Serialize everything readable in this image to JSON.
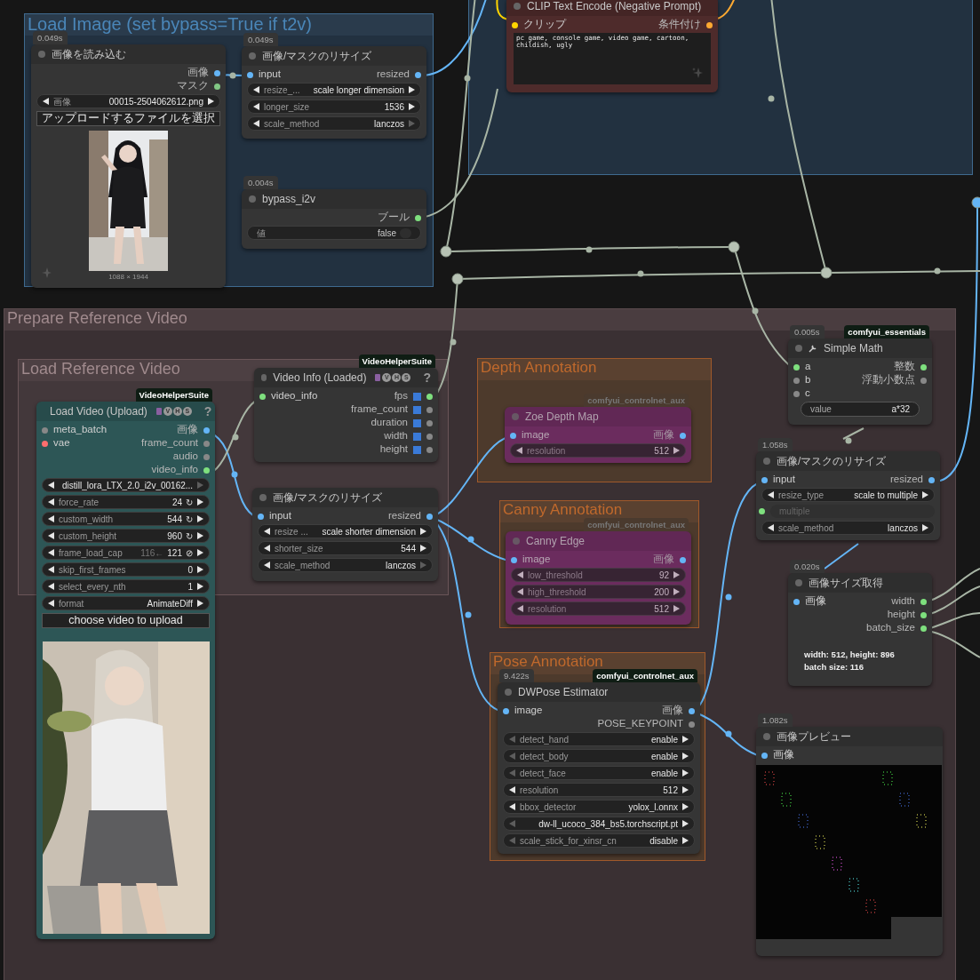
{
  "groups": [
    {
      "title": "Load Image (set bypass=True if t2v)",
      "color": "#4a86b8"
    },
    {
      "title": "Prepare Reference Video",
      "color": "#a08a8d"
    },
    {
      "title": "Load Reference Video",
      "color": "#a08a8d"
    },
    {
      "title": "Depth Annotation",
      "color": "#c0692c"
    },
    {
      "title": "Canny Annotation",
      "color": "#c0692c"
    },
    {
      "title": "Pose Annotation",
      "color": "#c0692c"
    }
  ],
  "nodes": [
    {
      "title": "画像を読み込む",
      "timing": "0.049s",
      "color": "#353535",
      "bypassed": false,
      "outputs": [
        {
          "label": "画像",
          "color": "#64b5f6"
        },
        {
          "label": "マスク",
          "color": "#81c784"
        }
      ],
      "widgets": [
        {
          "kind": "combo",
          "label": "画像",
          "value": "00015-2504062612.png"
        },
        {
          "kind": "button",
          "label": "アップロードするファイルを選択"
        }
      ],
      "preview": {
        "kind": "picture",
        "caption": "1088 × 1944"
      }
    },
    {
      "title": "画像/マスクのリサイズ",
      "timing": "0.049s",
      "color": "#353535",
      "bypassed": false,
      "inputs": [
        {
          "label": "input",
          "color": "#64b5f6"
        }
      ],
      "outputs": [
        {
          "label": "resized",
          "color": "#64b5f6"
        }
      ],
      "widgets": [
        {
          "kind": "combo",
          "label": "resize_...",
          "value": "scale longer dimension"
        },
        {
          "kind": "combo",
          "label": "longer_size",
          "value": "1536"
        },
        {
          "kind": "combo",
          "label": "scale_method",
          "value": "lanczos",
          "dim_next": true
        }
      ]
    },
    {
      "title": "bypass_i2v",
      "timing": "0.004s",
      "color": "#353535",
      "bypassed": false,
      "outputs": [
        {
          "label": "ブール",
          "color": "#7ee07e"
        }
      ],
      "widgets": [
        {
          "kind": "toggle",
          "label": "値",
          "value": "false",
          "on": false
        }
      ]
    },
    {
      "title": "CLIP Text Encode (Negative Prompt)",
      "color": "#4e2b2b",
      "bypassed": false,
      "inputs": [
        {
          "label": "クリップ",
          "color": "#ffd500"
        }
      ],
      "outputs": [
        {
          "label": "条件付け",
          "color": "#ffa931"
        }
      ],
      "widgets": [
        {
          "kind": "textarea",
          "value": "pc game, console game, video game, cartoon, childish, ugly"
        }
      ]
    },
    {
      "title": "Load Video (Upload)",
      "badge": "VideoHelperSuite",
      "suffix": [
        "V",
        "H",
        "S"
      ],
      "help": "?",
      "color": "#2d5656",
      "bypassed": false,
      "inputs": [
        {
          "label": "meta_batch",
          "color": "#888888"
        },
        {
          "label": "vae",
          "color": "#ff6e6e"
        }
      ],
      "outputs": [
        {
          "label": "画像",
          "color": "#64b5f6"
        },
        {
          "label": "frame_count",
          "color": "#888888"
        },
        {
          "label": "audio",
          "color": "#888888"
        },
        {
          "label": "video_info",
          "color": "#7ee07e"
        }
      ],
      "widgets": [
        {
          "kind": "combo",
          "value": "distill_lora_LTX_2.0_i2v_00162...",
          "dim_next": true
        },
        {
          "kind": "combo",
          "label": "force_rate",
          "value": "24",
          "glyph": "↻"
        },
        {
          "kind": "combo",
          "label": "custom_width",
          "value": "544",
          "glyph": "↻"
        },
        {
          "kind": "combo",
          "label": "custom_height",
          "value": "960",
          "glyph": "↻"
        },
        {
          "kind": "combo",
          "label": "frame_load_cap",
          "hint": "116←",
          "value": "121",
          "glyph": "⊘"
        },
        {
          "kind": "combo",
          "label": "skip_first_frames",
          "value": "0"
        },
        {
          "kind": "combo",
          "label": "select_every_nth",
          "value": "1"
        },
        {
          "kind": "combo",
          "label": "format",
          "value": "AnimateDiff"
        },
        {
          "kind": "button",
          "label": "choose video to upload"
        }
      ],
      "preview": {
        "kind": "picture"
      }
    },
    {
      "title": "Video Info (Loaded)",
      "badge": "VideoHelperSuite",
      "suffix": [
        "V",
        "H",
        "S"
      ],
      "help": "?",
      "color": "#353535",
      "bypassed": false,
      "output_squares": true,
      "inputs": [
        {
          "label": "video_info",
          "color": "#7ee07e"
        }
      ],
      "outputs": [
        {
          "label": "fps",
          "color": "#7ee07e"
        },
        {
          "label": "frame_count",
          "color": "#888888"
        },
        {
          "label": "duration",
          "color": "#888888"
        },
        {
          "label": "width",
          "color": "#888888"
        },
        {
          "label": "height",
          "color": "#888888"
        }
      ]
    },
    {
      "title": "画像/マスクのリサイズ",
      "color": "#353535",
      "bypassed": false,
      "inputs": [
        {
          "label": "input",
          "color": "#64b5f6"
        }
      ],
      "outputs": [
        {
          "label": "resized",
          "color": "#64b5f6"
        }
      ],
      "widgets": [
        {
          "kind": "combo",
          "label": "resize ...",
          "value": "scale shorter dimension"
        },
        {
          "kind": "combo",
          "label": "shorter_size",
          "value": "544"
        },
        {
          "kind": "combo",
          "label": "scale_method",
          "value": "lanczos",
          "dim_next": true
        }
      ]
    },
    {
      "title": "Zoe Depth Map",
      "badge": "comfyui_controlnet_aux",
      "color": "#6b2c5e",
      "bypassed": true,
      "inputs": [
        {
          "label": "image",
          "color": "#64b5f6"
        }
      ],
      "outputs": [
        {
          "label": "画像",
          "color": "#64b5f6"
        }
      ],
      "widgets": [
        {
          "kind": "combo",
          "label": "resolution",
          "value": "512"
        }
      ]
    },
    {
      "title": "Canny Edge",
      "badge": "comfyui_controlnet_aux",
      "color": "#6b2c5e",
      "bypassed": true,
      "inputs": [
        {
          "label": "image",
          "color": "#64b5f6"
        }
      ],
      "outputs": [
        {
          "label": "画像",
          "color": "#64b5f6"
        }
      ],
      "widgets": [
        {
          "kind": "combo",
          "label": "low_threshold",
          "value": "92"
        },
        {
          "kind": "combo",
          "label": "high_threshold",
          "value": "200"
        },
        {
          "kind": "combo",
          "label": "resolution",
          "value": "512"
        }
      ]
    },
    {
      "title": "DWPose Estimator",
      "timing": "9.422s",
      "badge": "comfyui_controlnet_aux",
      "color": "#353535",
      "bypassed": false,
      "inputs": [
        {
          "label": "image",
          "color": "#64b5f6"
        }
      ],
      "outputs": [
        {
          "label": "画像",
          "color": "#64b5f6"
        },
        {
          "label": "POSE_KEYPOINT",
          "color": "#888888"
        }
      ],
      "widgets": [
        {
          "kind": "combo",
          "label": "detect_hand",
          "value": "enable",
          "dim_prev": true
        },
        {
          "kind": "combo",
          "label": "detect_body",
          "value": "enable",
          "dim_prev": true
        },
        {
          "kind": "combo",
          "label": "detect_face",
          "value": "enable",
          "dim_prev": true
        },
        {
          "kind": "combo",
          "label": "resolution",
          "value": "512"
        },
        {
          "kind": "combo",
          "label": "bbox_detector",
          "value": "yolox_l.onnx"
        },
        {
          "kind": "combo",
          "value": "dw-ll_ucoco_384_bs5.torchscript.pt",
          "dim_prev": true
        },
        {
          "kind": "combo",
          "label": "scale_stick_for_xinsr_cn",
          "value": "disable",
          "dim_prev": true
        }
      ]
    },
    {
      "title": "Simple Math",
      "timing": "0.005s",
      "badge": "comfyui_essentials",
      "icon": true,
      "color": "#353535",
      "bypassed": false,
      "inputs": [
        {
          "label": "a",
          "color": "#7ee07e"
        },
        {
          "label": "b",
          "color": "#888888"
        },
        {
          "label": "c",
          "color": "#888888"
        }
      ],
      "outputs": [
        {
          "label": "整数",
          "color": "#7ee07e"
        },
        {
          "label": "浮動小数点",
          "color": "#888888"
        }
      ],
      "widgets": [
        {
          "kind": "text",
          "label": "value",
          "value": "a*32"
        }
      ]
    },
    {
      "title": "画像/マスクのリサイズ",
      "timing": "1.058s",
      "color": "#353535",
      "bypassed": false,
      "inputs": [
        {
          "label": "input",
          "color": "#64b5f6"
        }
      ],
      "outputs": [
        {
          "label": "resized",
          "color": "#64b5f6"
        }
      ],
      "widgets": [
        {
          "kind": "combo",
          "label": "resize_type",
          "value": "scale to multiple"
        },
        {
          "kind": "converted",
          "label": "multiple"
        },
        {
          "kind": "combo",
          "label": "scale_method",
          "value": "lanczos"
        }
      ]
    },
    {
      "title": "画像サイズ取得",
      "timing": "0.020s",
      "color": "#353535",
      "bypassed": false,
      "inputs": [
        {
          "label": "画像",
          "color": "#64b5f6"
        }
      ],
      "outputs": [
        {
          "label": "width",
          "color": "#7ee07e"
        },
        {
          "label": "height",
          "color": "#7ee07e"
        },
        {
          "label": "batch_size",
          "color": "#7ee07e"
        }
      ],
      "note": [
        "width: 512, height: 896",
        "batch size: 116"
      ]
    },
    {
      "title": "画像プレビュー",
      "timing": "1.082s",
      "color": "#353535",
      "bypassed": false,
      "inputs": [
        {
          "label": "画像",
          "color": "#64b5f6"
        }
      ],
      "preview": {
        "kind": "grid"
      }
    }
  ]
}
